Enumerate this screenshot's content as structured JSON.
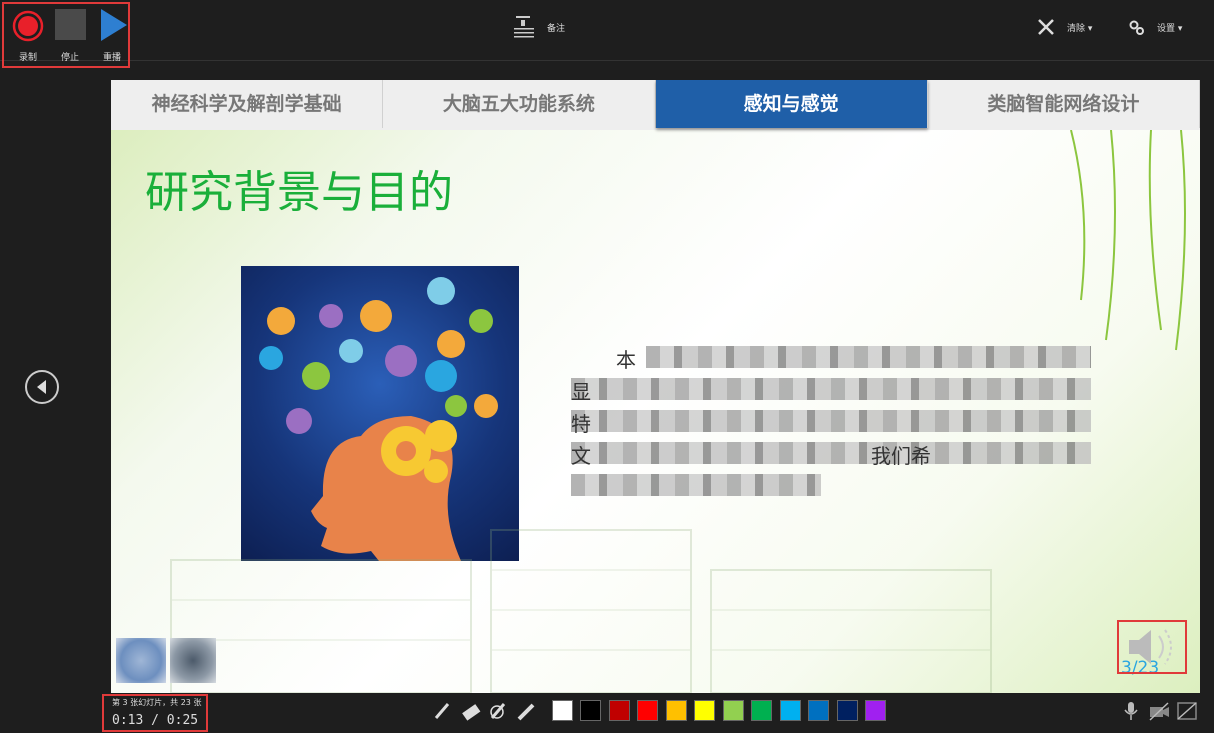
{
  "toolbar": {
    "record_label": "录制",
    "stop_label": "停止",
    "replay_label": "重播",
    "notes_label": "备注",
    "clear_label": "清除 ▾",
    "settings_label": "设置 ▾"
  },
  "slide": {
    "tabs": [
      {
        "label": "神经科学及解剖学基础",
        "active": false
      },
      {
        "label": "大脑五大功能系统",
        "active": false
      },
      {
        "label": "感知与感觉",
        "active": true
      },
      {
        "label": "类脑智能网络设计",
        "active": false
      }
    ],
    "title": "研究背景与目的",
    "page_number": "3/23",
    "text_fragments": [
      "本",
      "显",
      "特",
      "文",
      "我们希"
    ]
  },
  "status": {
    "slide_counter": "第 3 张幻灯片，共 23 张",
    "timer": "0:13  /  0:25"
  },
  "ink_colors": [
    "#ffffff",
    "#000000",
    "#c00000",
    "#ff0000",
    "#ffc000",
    "#ffff00",
    "#92d050",
    "#00b050",
    "#00b0f0",
    "#0070c0",
    "#002060",
    "#a020f0"
  ],
  "icons": [
    "record-icon",
    "stop-icon",
    "replay-icon",
    "notes-icon",
    "clear-icon",
    "settings-icon",
    "previous-slide-icon",
    "speaker-icon",
    "pen-icon",
    "eraser-icon",
    "laser-pen-icon",
    "highlighter-icon",
    "microphone-icon",
    "camera-off-icon",
    "camera-preview-off-icon"
  ],
  "colors": {
    "record_red": "#e8202a",
    "replay_blue": "#2e7fd1",
    "tab_active": "#1f5fa8",
    "title_green": "#1aaf3a",
    "annotation_box": "#e03a3a"
  }
}
